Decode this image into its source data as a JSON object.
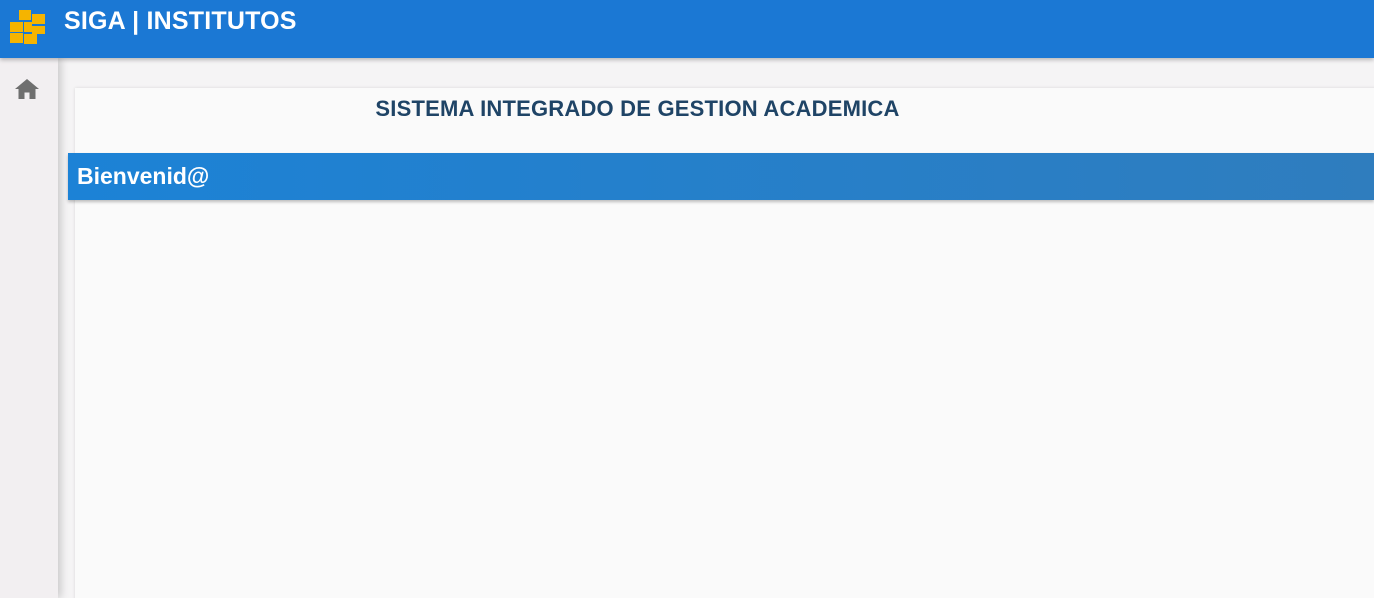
{
  "header": {
    "title": "SIGA | INSTITUTOS",
    "logo_icon": "siga-logo-icon",
    "background_color": "#1b78d4",
    "logo_color": "#f5b400"
  },
  "sidebar": {
    "items": [
      {
        "icon": "home-icon"
      }
    ]
  },
  "main": {
    "system_title": "SISTEMA INTEGRADO DE GESTION ACADEMICA",
    "welcome_banner": "Bienvenid@"
  }
}
